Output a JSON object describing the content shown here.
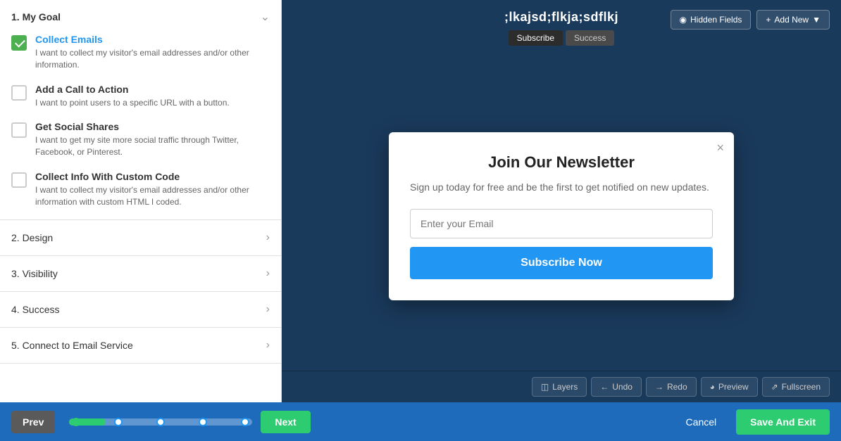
{
  "sidebar": {
    "section1_label": "1. My Goal",
    "goal_items": [
      {
        "title": "Collect Emails",
        "description": "I want to collect my visitor's email addresses and/or other information.",
        "selected": true
      },
      {
        "title": "Add a Call to Action",
        "description": "I want to point users to a specific URL with a button.",
        "selected": false
      },
      {
        "title": "Get Social Shares",
        "description": "I want to get my site more social traffic through Twitter, Facebook, or Pinterest.",
        "selected": false
      },
      {
        "title": "Collect Info With Custom Code",
        "description": "I want to collect my visitor's email addresses and/or other information with custom HTML I coded.",
        "selected": false
      }
    ],
    "section2_label": "2. Design",
    "section3_label": "3. Visibility",
    "section4_label": "4. Success",
    "section5_label": "5. Connect to Email Service"
  },
  "preview": {
    "title": ";lkajsd;flkja;sdflkj",
    "tab_subscribe": "Subscribe",
    "tab_success": "Success",
    "hidden_fields_btn": "Hidden Fields",
    "add_new_btn": "Add New"
  },
  "modal": {
    "title": "Join Our Newsletter",
    "subtitle": "Sign up today for free and be the first to get notified on new updates.",
    "email_placeholder": "Enter your Email",
    "subscribe_btn": "Subscribe Now",
    "close_icon": "×"
  },
  "toolbar": {
    "layers_btn": "Layers",
    "undo_btn": "Undo",
    "redo_btn": "Redo",
    "preview_btn": "Preview",
    "fullscreen_btn": "Fullscreen"
  },
  "bottom_nav": {
    "prev_btn": "Prev",
    "next_btn": "Next",
    "cancel_btn": "Cancel",
    "save_exit_btn": "Save And Exit"
  },
  "colors": {
    "accent_blue": "#2196F3",
    "accent_green": "#2ecc71",
    "dark_bg": "#1a3a5c",
    "nav_bg": "#1e6bbc"
  }
}
